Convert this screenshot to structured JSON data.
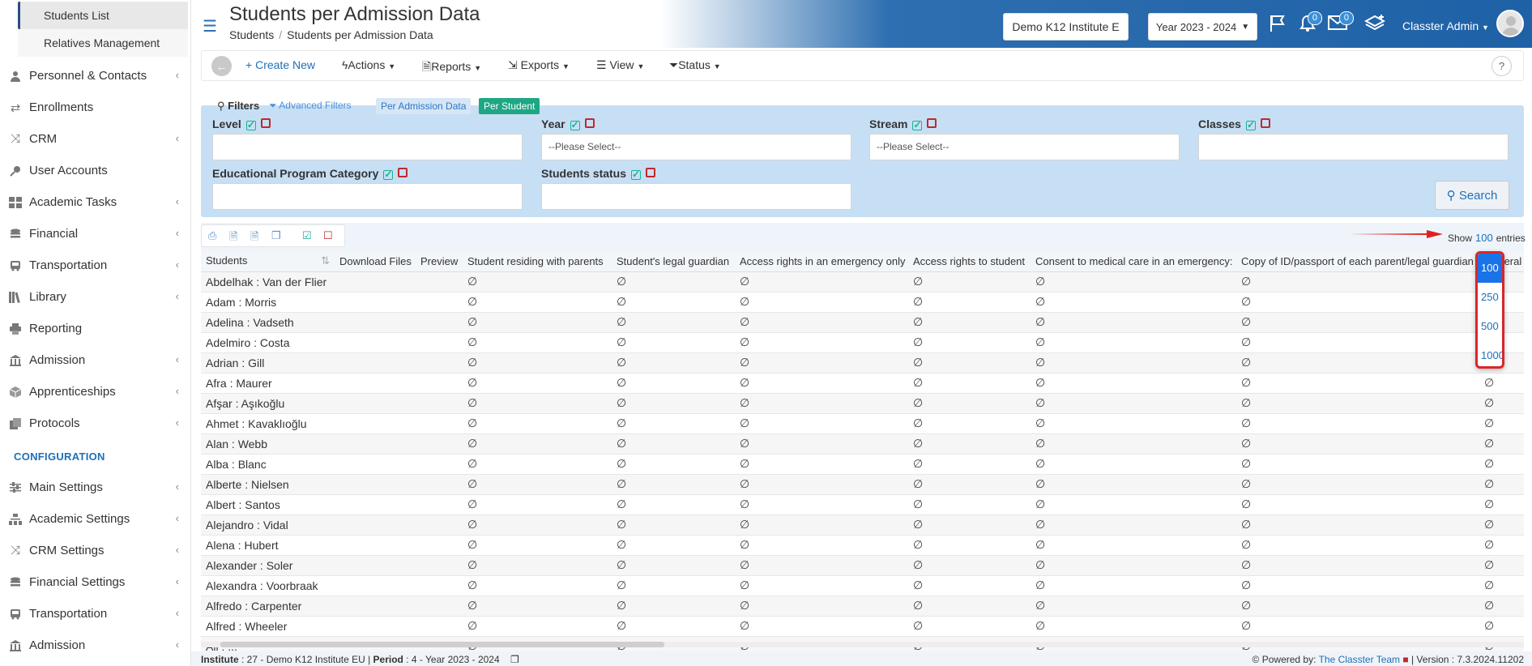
{
  "sidebar": {
    "sub_items": [
      {
        "label": "Students List"
      },
      {
        "label": "Relatives Management"
      }
    ],
    "items": [
      {
        "label": "Personnel & Contacts",
        "icon": "person-icon"
      },
      {
        "label": "Enrollments",
        "icon": "exchange-icon"
      },
      {
        "label": "CRM",
        "icon": "crm-icon"
      },
      {
        "label": "User Accounts",
        "icon": "key-icon"
      },
      {
        "label": "Academic Tasks",
        "icon": "grid-icon"
      },
      {
        "label": "Financial",
        "icon": "coins-icon"
      },
      {
        "label": "Transportation",
        "icon": "bus-icon"
      },
      {
        "label": "Library",
        "icon": "books-icon"
      },
      {
        "label": "Reporting",
        "icon": "printer-icon"
      },
      {
        "label": "Admission",
        "icon": "institution-icon"
      },
      {
        "label": "Apprenticeships",
        "icon": "cube-icon"
      },
      {
        "label": "Protocols",
        "icon": "protocol-icon"
      }
    ],
    "config_title": "CONFIGURATION",
    "config_items": [
      {
        "label": "Main Settings",
        "icon": "sliders-icon"
      },
      {
        "label": "Academic Settings",
        "icon": "sitemap-icon"
      },
      {
        "label": "CRM Settings",
        "icon": "crm-icon"
      },
      {
        "label": "Financial Settings",
        "icon": "coins-icon"
      },
      {
        "label": "Transportation",
        "icon": "bus-icon"
      },
      {
        "label": "Admission",
        "icon": "institution-icon"
      }
    ]
  },
  "header": {
    "title": "Students per Admission Data",
    "breadcrumb": [
      "Students",
      "Students per Admission Data"
    ],
    "institute": "Demo K12 Institute E",
    "year": "Year 2023 - 2024",
    "notifications_count": "0",
    "messages_count": "0",
    "user": "Classter Admin"
  },
  "toolbar": {
    "create_new": "Create New",
    "actions": "Actions",
    "reports": "Reports",
    "exports": "Exports",
    "view": "View",
    "status": "Status",
    "help": "?"
  },
  "filters": {
    "title": "Filters",
    "advanced": "Advanced Filters",
    "tab_admission": "Per Admission Data",
    "tab_student": "Per Student",
    "level_label": "Level",
    "year_label": "Year",
    "stream_label": "Stream",
    "classes_label": "Classes",
    "epc_label": "Educational Program Category",
    "status_label": "Students status",
    "year_placeholder": "--Please Select--",
    "stream_placeholder": "--Please Select--",
    "search": "Search"
  },
  "table": {
    "show_label": "Show",
    "show_value": "100",
    "entries_label": "entries",
    "columns": [
      "Students",
      "Download Files",
      "Preview",
      "Student residing with parents",
      "Student's legal guardian",
      "Access rights in an emergency only",
      "Access rights to student",
      "Consent to medical care in an emergency:",
      "Copy of ID/passport of each parent/legal guardian",
      "General"
    ],
    "rows": [
      "Abdelhak : Van der Flier",
      "Adam : Morris",
      "Adelina : Vadseth",
      "Adelmiro : Costa",
      "Adrian : Gill",
      "Afra : Maurer",
      "Afşar : Aşıkoğlu",
      "Ahmet : Kavaklıoğlu",
      "Alan : Webb",
      "Alba : Blanc",
      "Alberte : Nielsen",
      "Albert : Santos",
      "Alejandro : Vidal",
      "Alena : Hubert",
      "Alexander : Soler",
      "Alexandra : Voorbraak",
      "Alfredo : Carpenter",
      "Alfred : Wheeler",
      "Ali : ..."
    ],
    "nil_symbol": "∅",
    "page_size_options": [
      "100",
      "250",
      "500",
      "1000"
    ]
  },
  "footer": {
    "institute_label": "Institute",
    "institute_value": ": 27 - Demo K12 Institute EU |",
    "period_label": "Period",
    "period_value": ": 4 - Year 2023 - 2024",
    "powered_by": "Powered by:",
    "team": "The Classter Team",
    "version": "| Version : 7.3.2024.11202"
  }
}
